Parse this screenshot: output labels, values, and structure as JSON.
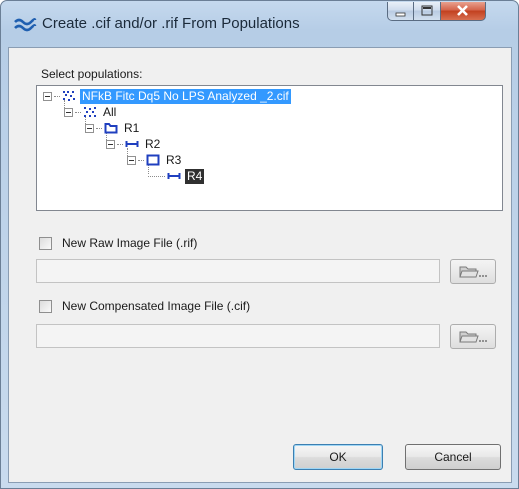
{
  "window": {
    "title": "Create .cif and/or .rif From Populations",
    "controls": {
      "minimize": "minimize-icon",
      "maximize": "maximize-icon",
      "close": "close-icon"
    }
  },
  "populations": {
    "label": "Select populations:",
    "tree": [
      {
        "label": "NFkB Fitc Dq5 No LPS Analyzed _2.cif",
        "icon": "file-dots-icon",
        "state": "selected"
      },
      {
        "label": "All",
        "icon": "dots-icon"
      },
      {
        "label": "R1",
        "icon": "polygon-region-icon"
      },
      {
        "label": "R2",
        "icon": "line-gate-icon"
      },
      {
        "label": "R3",
        "icon": "rectangle-region-icon"
      },
      {
        "label": "R4",
        "icon": "line-gate-icon",
        "state": "highlighted"
      }
    ]
  },
  "raw_file": {
    "label": "New Raw Image File (.rif)",
    "checked": false,
    "path": ""
  },
  "comp_file": {
    "label": "New Compensated Image File (.cif)",
    "checked": false,
    "path": ""
  },
  "buttons": {
    "ok": "OK",
    "cancel": "Cancel"
  },
  "colors": {
    "selection": "#3399ff",
    "icon_blue": "#1f3fbf",
    "highlight": "#303030"
  }
}
